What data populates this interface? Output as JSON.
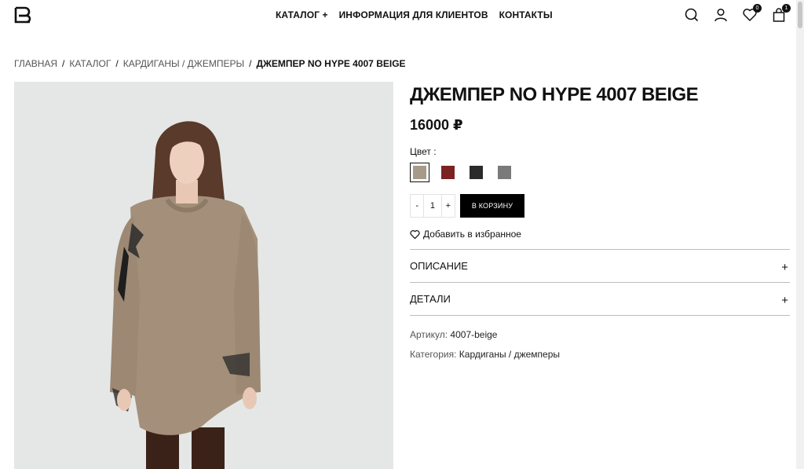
{
  "header": {
    "nav": {
      "catalog": "КАТАЛОГ +",
      "info": "ИНФОРМАЦИЯ ДЛЯ КЛИЕНТОВ",
      "contacts": "КОНТАКТЫ"
    },
    "icons": {
      "search": "search-icon",
      "account": "user-icon",
      "wishlist": "heart-icon",
      "cart": "shopping-bag-icon"
    },
    "wishlist_count": "0",
    "cart_count": "1"
  },
  "breadcrumb": {
    "home": "ГЛАВНАЯ",
    "catalog": "КАТАЛОГ",
    "category": "КАРДИГАНЫ / ДЖЕМПЕРЫ",
    "current": "ДЖЕМПЕР NO HYPE 4007 BEIGE",
    "separator": "/"
  },
  "product": {
    "title": "ДЖЕМПЕР NO HYPE 4007 BEIGE",
    "price": "16000 ₽",
    "color_label": "Цвет :",
    "colors": [
      {
        "name": "beige",
        "hex": "#a89a8a",
        "selected": true
      },
      {
        "name": "burgundy",
        "hex": "#7b2222",
        "selected": false
      },
      {
        "name": "black",
        "hex": "#2b2b2b",
        "selected": false
      },
      {
        "name": "grey",
        "hex": "#7a7a7a",
        "selected": false
      }
    ],
    "qty_minus": "-",
    "qty_value": "1",
    "qty_plus": "+",
    "add_to_cart": "В КОРЗИНУ",
    "add_to_favorites": "Добавить в избранное",
    "accordion": {
      "description": "ОПИСАНИЕ",
      "details": "ДЕТАЛИ",
      "toggle": "+"
    },
    "sku_label": "Артикул:",
    "sku_value": "4007-beige",
    "category_label": "Категория:",
    "category_value": "Кардиганы / джемперы"
  },
  "colors": {
    "accent": "#000000",
    "image_background": "#e4e7e6",
    "sweater": "#a4907a"
  }
}
